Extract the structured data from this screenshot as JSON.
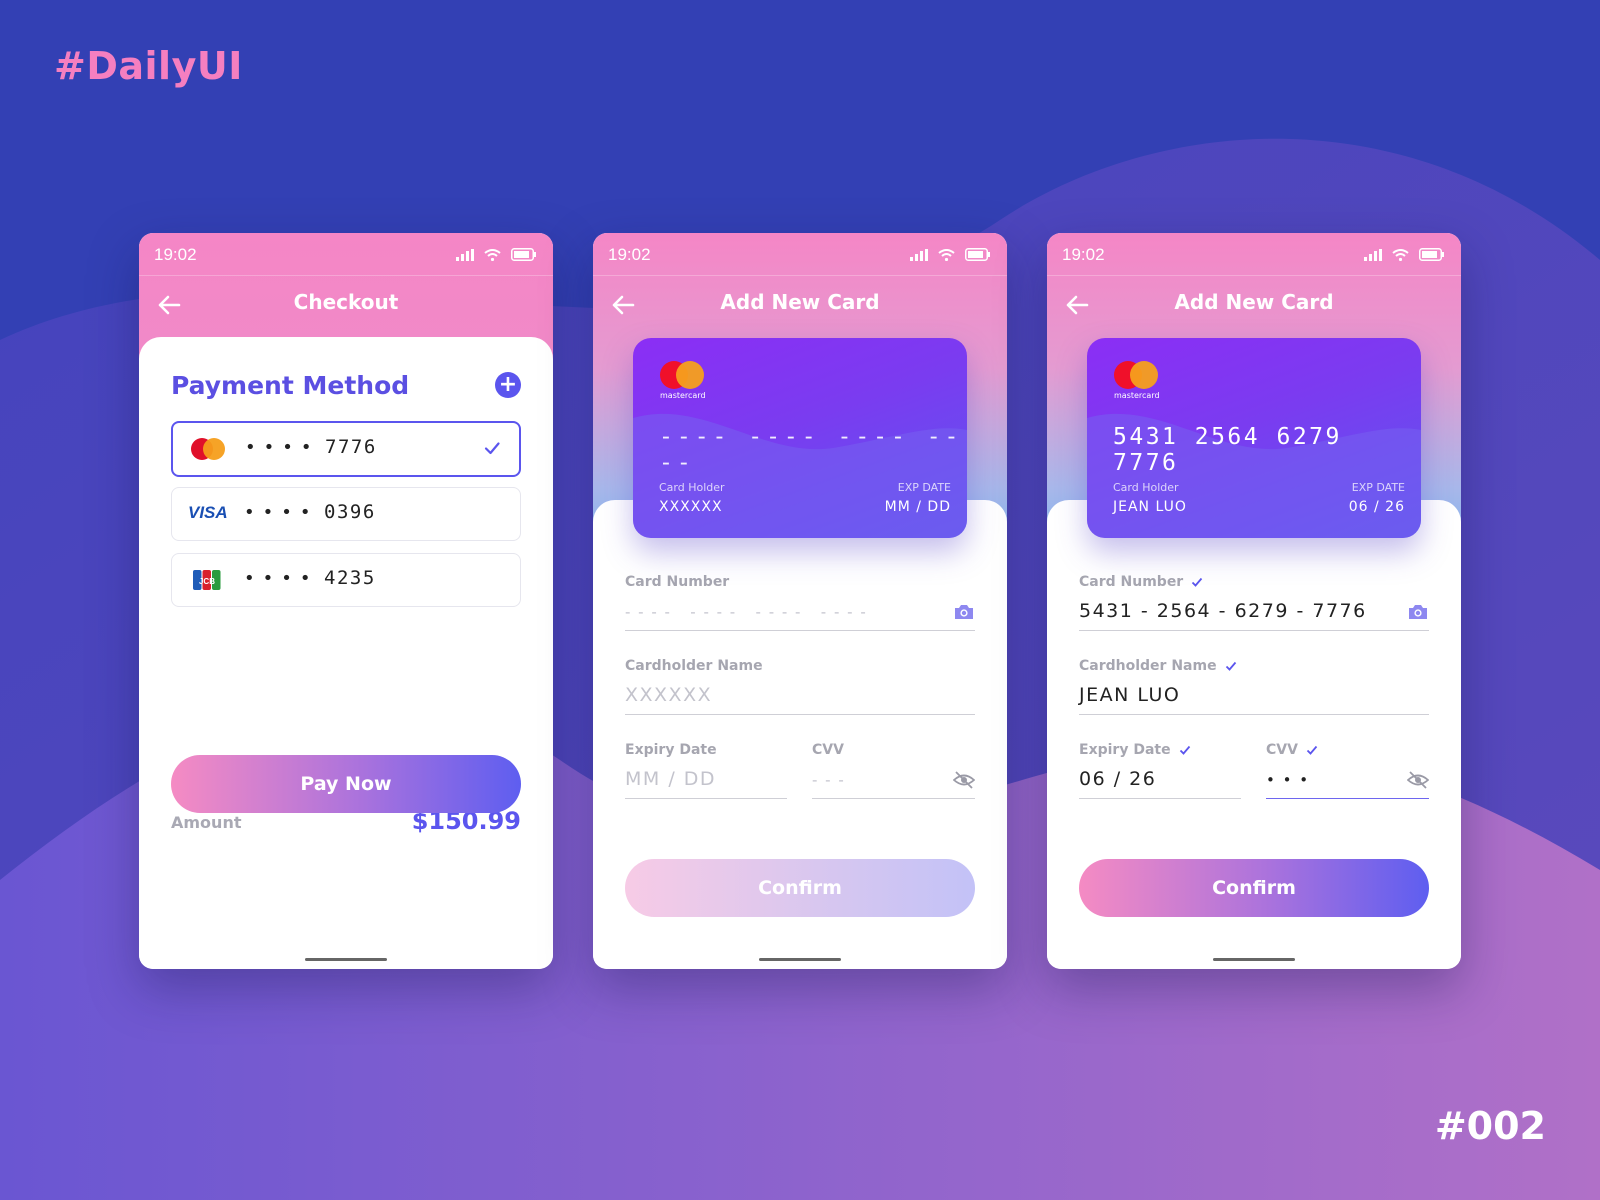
{
  "brand": "#DailyUI",
  "shot_id": "#002",
  "colors": {
    "background": "#3340b4",
    "accent": "#5b55ee",
    "pink": "#f586c6"
  },
  "checkout": {
    "status_time": "19:02",
    "title": "Checkout",
    "section_title": "Payment Method",
    "add_icon": "plus-circle-icon",
    "cards": [
      {
        "brand": "mastercard",
        "dots": "••••",
        "last4": "7776",
        "selected": true
      },
      {
        "brand": "VISA",
        "dots": "••••",
        "last4": "0396",
        "selected": false
      },
      {
        "brand": "JCB",
        "dots": "••••",
        "last4": "4235",
        "selected": false
      }
    ],
    "amount_label": "Amount",
    "amount_value": "$150.99",
    "pay_button": "Pay Now"
  },
  "add_card_empty": {
    "status_time": "19:02",
    "title": "Add New Card",
    "card": {
      "logo_text": "mastercard",
      "number": "---- ---- ---- ----",
      "holder_label": "Card Holder",
      "holder": "XXXXXX",
      "exp_label": "EXP DATE",
      "exp": "MM / DD"
    },
    "fields": {
      "card_number_label": "Card Number",
      "card_number_placeholder": "- - - -   - - - -   - - - -   - - - -",
      "name_label": "Cardholder Name",
      "name_placeholder": "XXXXXX",
      "expiry_label": "Expiry Date",
      "expiry_placeholder": "MM / DD",
      "cvv_label": "CVV",
      "cvv_placeholder": "- - -"
    },
    "confirm_button": "Confirm"
  },
  "add_card_filled": {
    "status_time": "19:02",
    "title": "Add New Card",
    "card": {
      "logo_text": "mastercard",
      "number": "5431 2564 6279 7776",
      "holder_label": "Card Holder",
      "holder": "JEAN LUO",
      "exp_label": "EXP DATE",
      "exp": "06 / 26"
    },
    "fields": {
      "card_number_label": "Card Number",
      "card_number_value": "5431 - 2564 - 6279 - 7776",
      "name_label": "Cardholder Name",
      "name_value": "JEAN LUO",
      "expiry_label": "Expiry Date",
      "expiry_value": "06 / 26",
      "cvv_label": "CVV",
      "cvv_value": "• • •"
    },
    "confirm_button": "Confirm"
  }
}
